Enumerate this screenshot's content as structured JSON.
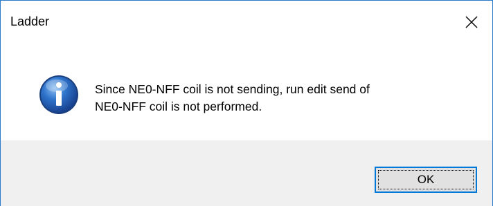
{
  "window": {
    "title": "Ladder",
    "close_icon": "close-icon"
  },
  "message": {
    "icon": "info-icon",
    "line1": "Since NE0-NFF coil is not sending, run edit send of",
    "line2": "NE0-NFF coil is not performed."
  },
  "buttons": {
    "ok_label": "OK"
  },
  "colors": {
    "border": "#2b79c8",
    "footer_bg": "#f0f0f0",
    "button_bg": "#e1e1e1",
    "button_border": "#0078d7",
    "icon_blue": "#1d5fb0"
  }
}
